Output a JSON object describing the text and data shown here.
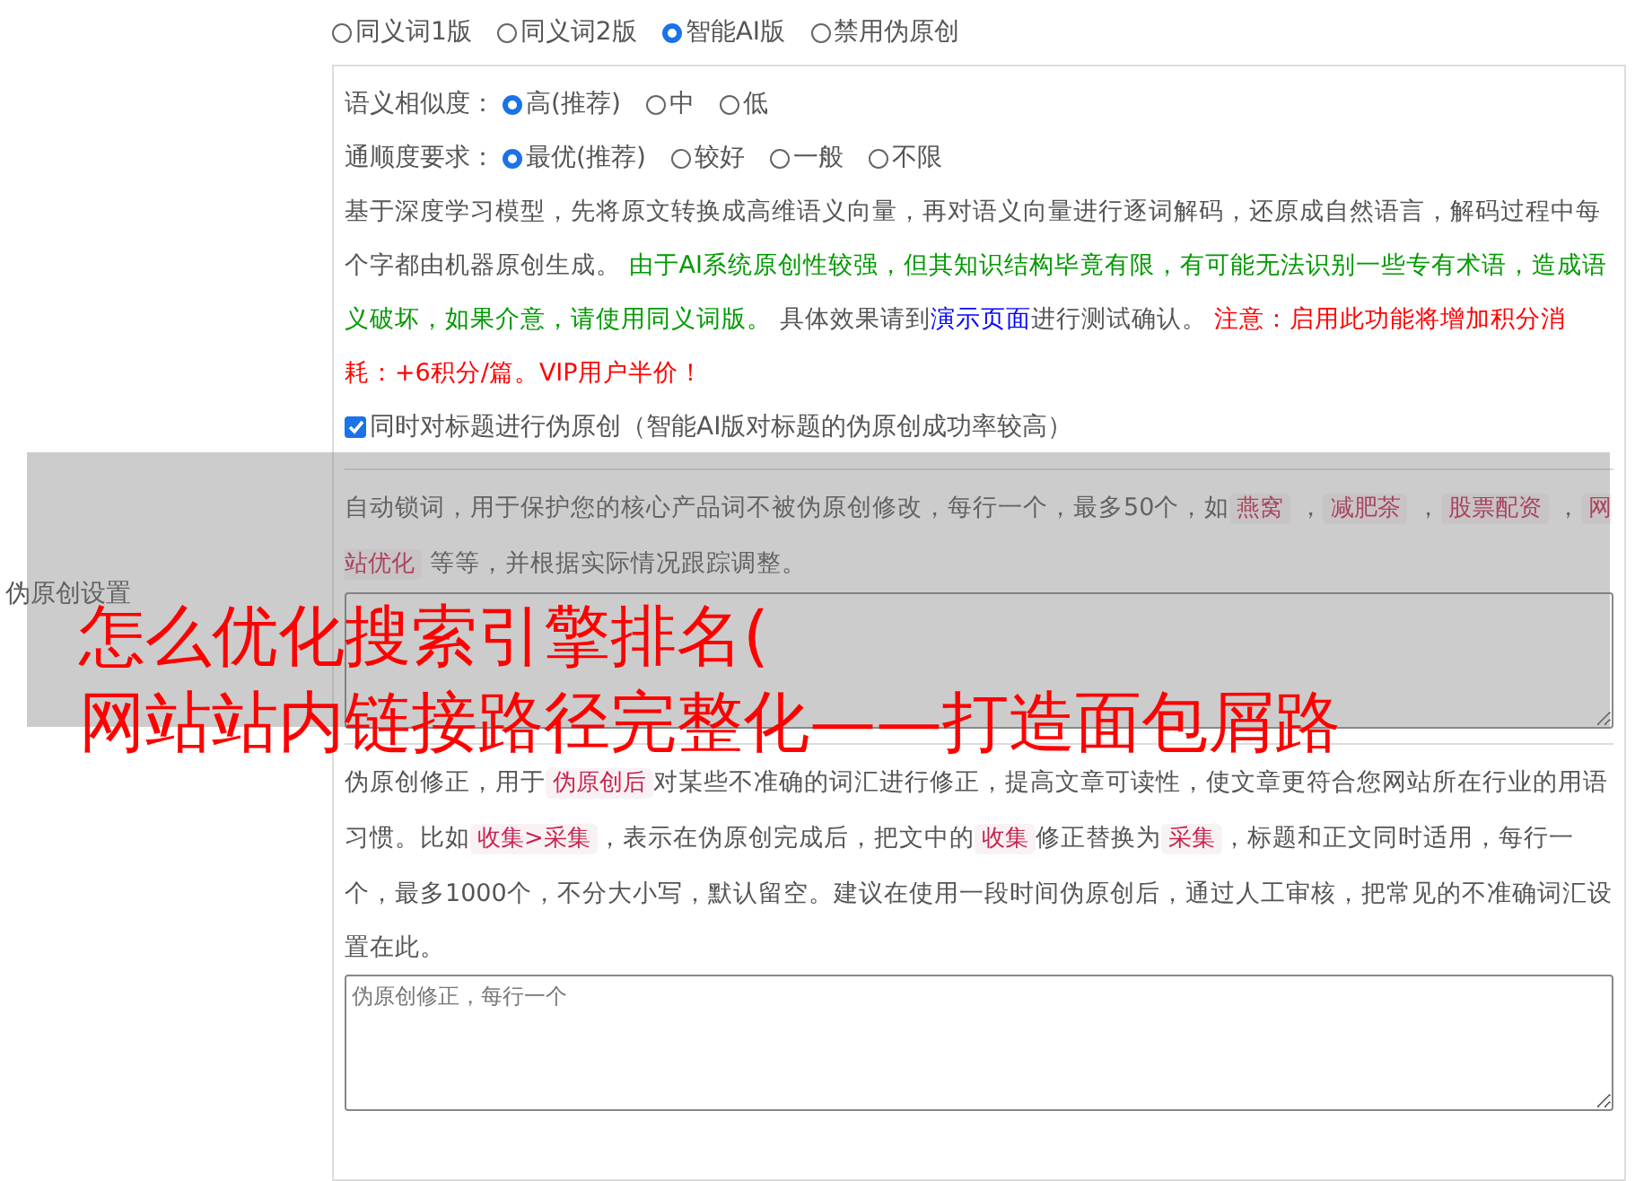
{
  "sidebar_label": "伪原创设置",
  "mode_options": [
    {
      "label": "同义词1版",
      "selected": false
    },
    {
      "label": "同义词2版",
      "selected": false
    },
    {
      "label": "智能AI版",
      "selected": true
    },
    {
      "label": "禁用伪原创",
      "selected": false
    }
  ],
  "similarity": {
    "label": "语义相似度：",
    "options": [
      {
        "label": "高(推荐)",
        "selected": true
      },
      {
        "label": "中",
        "selected": false
      },
      {
        "label": "低",
        "selected": false
      }
    ]
  },
  "fluency": {
    "label": "通顺度要求：",
    "options": [
      {
        "label": "最优(推荐)",
        "selected": true
      },
      {
        "label": "较好",
        "selected": false
      },
      {
        "label": "一般",
        "selected": false
      },
      {
        "label": "不限",
        "selected": false
      }
    ]
  },
  "description": [
    {
      "kind": "plain",
      "text": "基于深度学习模型，先将原文转换成高维语义向量，再对语义向量进行逐词解码，还原成自然语言，解码过程中每个字都由机器原创生成。 "
    },
    {
      "kind": "green",
      "text": "由于AI系统原创性较强，但其知识结构毕竟有限，有可能无法识别一些专有术语，造成语义破坏，如果介意，请使用同义词版。"
    },
    {
      "kind": "plain",
      "text": " 具体效果请到"
    },
    {
      "kind": "link",
      "text": "演示页面"
    },
    {
      "kind": "plain",
      "text": "进行测试确认。 "
    },
    {
      "kind": "red",
      "text": "注意：启用此功能将增加积分消耗：+6积分/篇。VIP用户半价！"
    }
  ],
  "title_checkbox": {
    "label": "同时对标题进行伪原创（智能AI版对标题的伪原创成功率较高）",
    "checked": true
  },
  "lock_words": {
    "description": [
      {
        "kind": "plain",
        "text": "自动锁词，用于保护您的核心产品词不被伪原创修改，每行一个，最多50个，如"
      },
      {
        "kind": "code",
        "text": "燕窝"
      },
      {
        "kind": "plain",
        "text": " ，"
      },
      {
        "kind": "code",
        "text": "减肥茶"
      },
      {
        "kind": "plain",
        "text": " ，"
      },
      {
        "kind": "code",
        "text": "股票配资"
      },
      {
        "kind": "plain",
        "text": " ，"
      },
      {
        "kind": "code",
        "text": "网站优化"
      },
      {
        "kind": "plain",
        "text": " 等等，并根据实际情况跟踪调整。"
      }
    ]
  },
  "correction": {
    "description": [
      {
        "kind": "plain",
        "text": "伪原创修正，用于"
      },
      {
        "kind": "code",
        "text": "伪原创后"
      },
      {
        "kind": "plain",
        "text": "对某些不准确的词汇进行修正，提高文章可读性，使文章更符合您网站所在行业的用语习惯。比如"
      },
      {
        "kind": "code",
        "text": "收集>采集"
      },
      {
        "kind": "plain",
        "text": "，表示在伪原创完成后，把文中的"
      },
      {
        "kind": "code",
        "text": "收集"
      },
      {
        "kind": "plain",
        "text": "修正替换为"
      },
      {
        "kind": "code",
        "text": "采集"
      },
      {
        "kind": "plain",
        "text": "，标题和正文同时适用，每行一个，最多1000个，不分大小写，默认留空。建议在使用一段时间伪原创后，通过人工审核，把常见的不准确词汇设置在此。"
      }
    ],
    "placeholder": "伪原创修正，每行一个"
  },
  "overlay_title": [
    "怎么优化搜索引擎排名(",
    "网站站内链接路径完整化——打造面包屑路"
  ]
}
